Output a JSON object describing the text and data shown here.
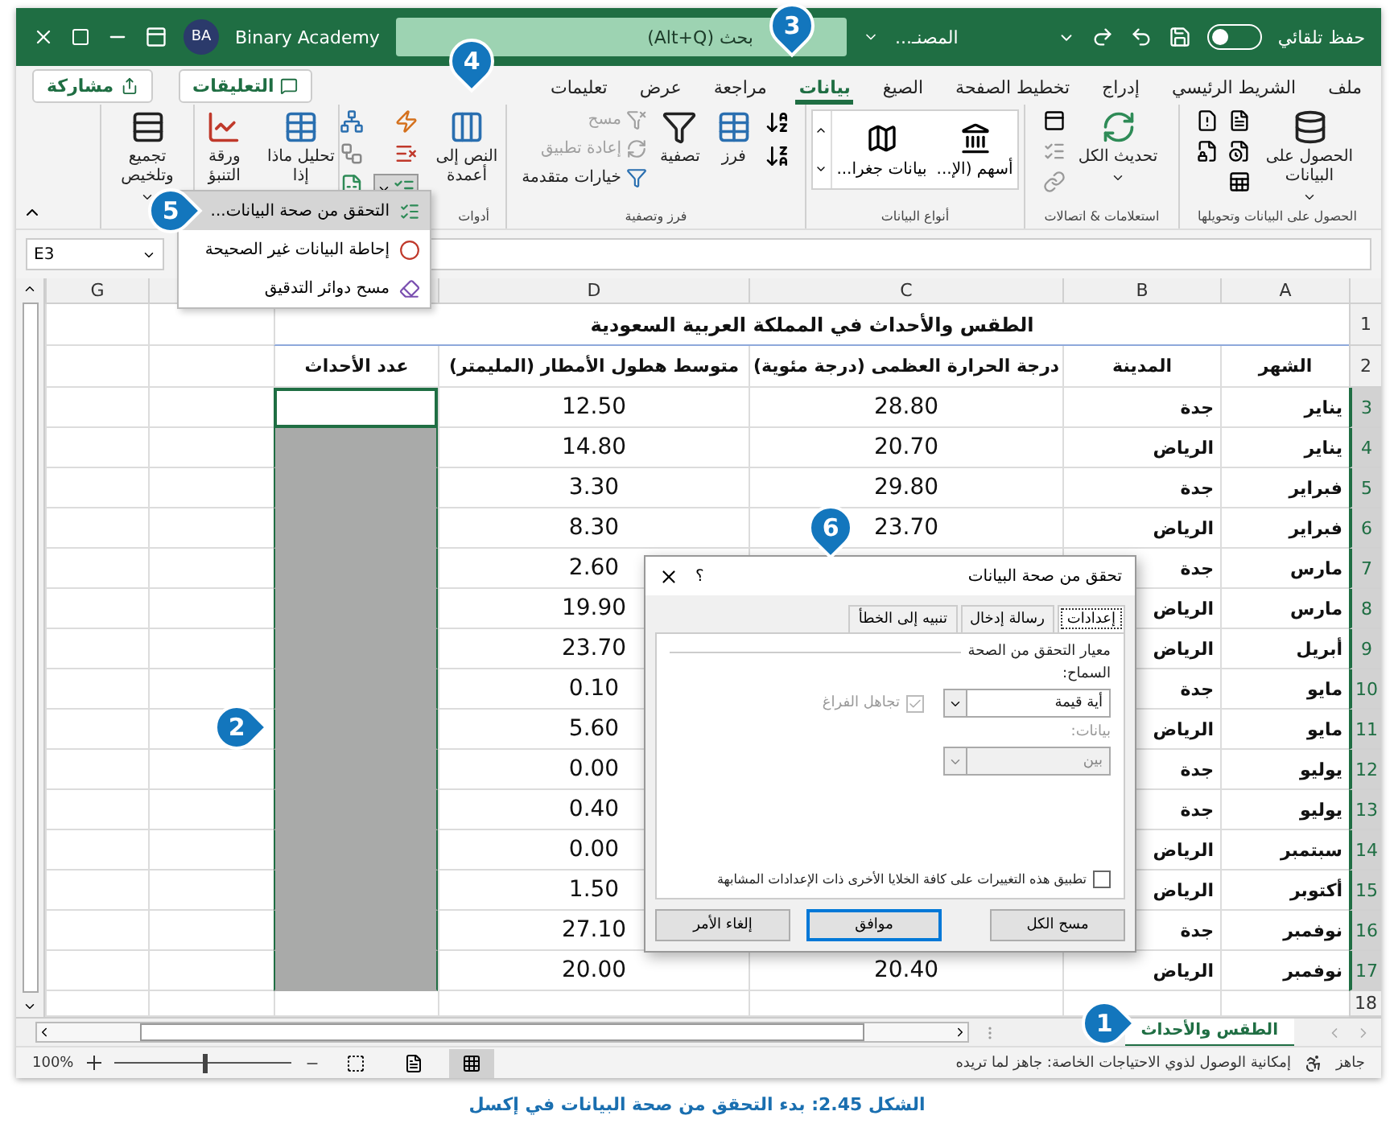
{
  "title_bar": {
    "autosave_label": "حفظ تلقائي",
    "autosave_on": false,
    "file_name": "المصنـ...",
    "search_placeholder": "بحث (Alt+Q)",
    "user_initials": "BA",
    "user_name": "Binary Academy"
  },
  "ribbon_tabs": [
    {
      "label": "ملف",
      "selected": false
    },
    {
      "label": "الشريط الرئيسي",
      "selected": false
    },
    {
      "label": "إدراج",
      "selected": false
    },
    {
      "label": "تخطيط الصفحة",
      "selected": false
    },
    {
      "label": "الصيغ",
      "selected": false
    },
    {
      "label": "بيانات",
      "selected": true
    },
    {
      "label": "مراجعة",
      "selected": false
    },
    {
      "label": "عرض",
      "selected": false
    },
    {
      "label": "تعليمات",
      "selected": false
    }
  ],
  "comments_button": "التعليقات",
  "share_button": "مشاركة",
  "ribbon": {
    "get_data": {
      "label": "الحصول على البيانات وتحويلها",
      "button": "الحصول على البيانات"
    },
    "queries": {
      "label": "استعلامات & اتصالات",
      "button": "تحديث الكل"
    },
    "data_types": {
      "label": "أنواع البيانات",
      "items": [
        "أسهم (الإ...",
        "بيانات جغرا..."
      ]
    },
    "sort_filter": {
      "label": "فرز وتصفية",
      "sort": "فرز",
      "filter": "تصفية",
      "small": [
        {
          "label": "مسح",
          "disabled": true
        },
        {
          "label": "إعادة تطبيق",
          "disabled": true
        },
        {
          "label": "خيارات متقدمة",
          "disabled": false
        }
      ]
    },
    "tools": {
      "label": "أدوات",
      "text_to_columns": "النص إلى أعمدة",
      "validation_open": true
    },
    "forecast": {
      "what_if": "تحليل ماذا إذا",
      "sheet": "ورقة التنبؤ"
    },
    "outline": {
      "button": "تجميع وتلخيص"
    }
  },
  "validation_menu": [
    {
      "label": "التحقق من صحة البيانات...",
      "selected": true
    },
    {
      "label": "إحاطة البيانات غير الصحيحة",
      "selected": false
    },
    {
      "label": "مسح دوائر التدقيق",
      "selected": false
    }
  ],
  "name_box": "E3",
  "columns": [
    {
      "label": "A"
    },
    {
      "label": "B"
    },
    {
      "label": "C"
    },
    {
      "label": "D"
    },
    {},
    {},
    {
      "label": "G"
    }
  ],
  "sheet_title": "الطقس والأحداث في المملكة العربية السعودية",
  "header_row": {
    "number": "2",
    "month": "الشهر",
    "city": "المدينة",
    "temperature": "درجة الحرارة العظمى (درجة مئوية)",
    "rainfall": "متوسط هطول الأمطار (المليمتر)",
    "events": "عدد الأحداث"
  },
  "title_row_number": "1",
  "rows": [
    {
      "number": "3",
      "selected": true,
      "month": "يناير",
      "city": "جدة",
      "temperature": "28.80",
      "rainfall": "12.50",
      "events_selected": true,
      "events_active": true
    },
    {
      "number": "4",
      "selected": true,
      "month": "يناير",
      "city": "الرياض",
      "temperature": "20.70",
      "rainfall": "14.80",
      "events_selected": true,
      "events_active": false
    },
    {
      "number": "5",
      "selected": true,
      "month": "فبراير",
      "city": "جدة",
      "temperature": "29.80",
      "rainfall": "3.30",
      "events_selected": true,
      "events_active": false
    },
    {
      "number": "6",
      "selected": true,
      "month": "فبراير",
      "city": "الرياض",
      "temperature": "23.70",
      "rainfall": "8.30",
      "events_selected": true,
      "events_active": false
    },
    {
      "number": "7",
      "selected": true,
      "month": "مارس",
      "city": "جدة",
      "rainfall": "2.60",
      "events_selected": true,
      "events_active": false
    },
    {
      "number": "8",
      "selected": true,
      "month": "مارس",
      "city": "الرياض",
      "rainfall": "19.90",
      "events_selected": true,
      "events_active": false
    },
    {
      "number": "9",
      "selected": true,
      "month": "أبريل",
      "city": "الرياض",
      "rainfall": "23.70",
      "events_selected": true,
      "events_active": false
    },
    {
      "number": "10",
      "selected": true,
      "month": "مايو",
      "city": "جدة",
      "rainfall": "0.10",
      "events_selected": true,
      "events_active": false
    },
    {
      "number": "11",
      "selected": true,
      "month": "مايو",
      "city": "الرياض",
      "rainfall": "5.60",
      "events_selected": true,
      "events_active": false
    },
    {
      "number": "12",
      "selected": true,
      "month": "يوليو",
      "city": "جدة",
      "rainfall": "0.00",
      "events_selected": true,
      "events_active": false
    },
    {
      "number": "13",
      "selected": true,
      "month": "يوليو",
      "city": "جدة",
      "rainfall": "0.40",
      "events_selected": true,
      "events_active": false
    },
    {
      "number": "14",
      "selected": true,
      "month": "سبتمبر",
      "city": "الرياض",
      "rainfall": "0.00",
      "events_selected": true,
      "events_active": false
    },
    {
      "number": "15",
      "selected": true,
      "month": "أكتوبر",
      "city": "الرياض",
      "rainfall": "1.50",
      "events_selected": true,
      "events_active": false
    },
    {
      "number": "16",
      "selected": true,
      "month": "نوفمبر",
      "city": "جدة",
      "rainfall": "27.10",
      "events_selected": true,
      "events_active": false
    },
    {
      "number": "17",
      "selected": true,
      "month": "نوفمبر",
      "city": "الرياض",
      "temperature": "20.40",
      "rainfall": "20.00",
      "events_selected": true,
      "events_active": false
    }
  ],
  "last_row_number": "18",
  "dialog": {
    "title": "تحقق من صحة البيانات",
    "help": "؟",
    "tabs": [
      {
        "label": "إعدادات",
        "selected": true
      },
      {
        "label": "رسالة إدخال",
        "selected": false
      },
      {
        "label": "تنبيه إلى الخطأ",
        "selected": false
      }
    ],
    "section": "معيار التحقق من الصحة",
    "allow_label": "السماح:",
    "allow_value": "أية قيمة",
    "ignore_blank": {
      "label": "تجاهل الفراغ",
      "checked": true,
      "disabled": true
    },
    "data_label": "بيانات:",
    "data_value": "بين",
    "data_disabled": true,
    "apply_all": {
      "label": "تطبيق هذه التغييرات على كافة الخلايا الأخرى ذات الإعدادات المشابهة",
      "checked": false
    },
    "buttons": [
      {
        "label": "مسح الكل",
        "default": false
      },
      {
        "label": "موافق",
        "default": true
      },
      {
        "label": "إلغاء الأمر",
        "default": false
      }
    ]
  },
  "sheet_tabs": [
    {
      "label": "الطقس والأحداث",
      "selected": true
    }
  ],
  "status_bar": {
    "ready": "جاهز",
    "accessibility": "إمكانية الوصول لذوي الاحتياجات الخاصة: جاهز لما تريده",
    "views": [
      {
        "selected": true
      },
      {
        "selected": false
      },
      {
        "selected": false
      }
    ],
    "zoom_slider": {
      "level": 0.5
    },
    "zoom": "100%"
  },
  "callouts": [
    "1",
    "2",
    "3",
    "4",
    "5",
    "6"
  ],
  "caption": "الشكل 2.45: بدء التحقق من صحة البيانات في إكسل"
}
